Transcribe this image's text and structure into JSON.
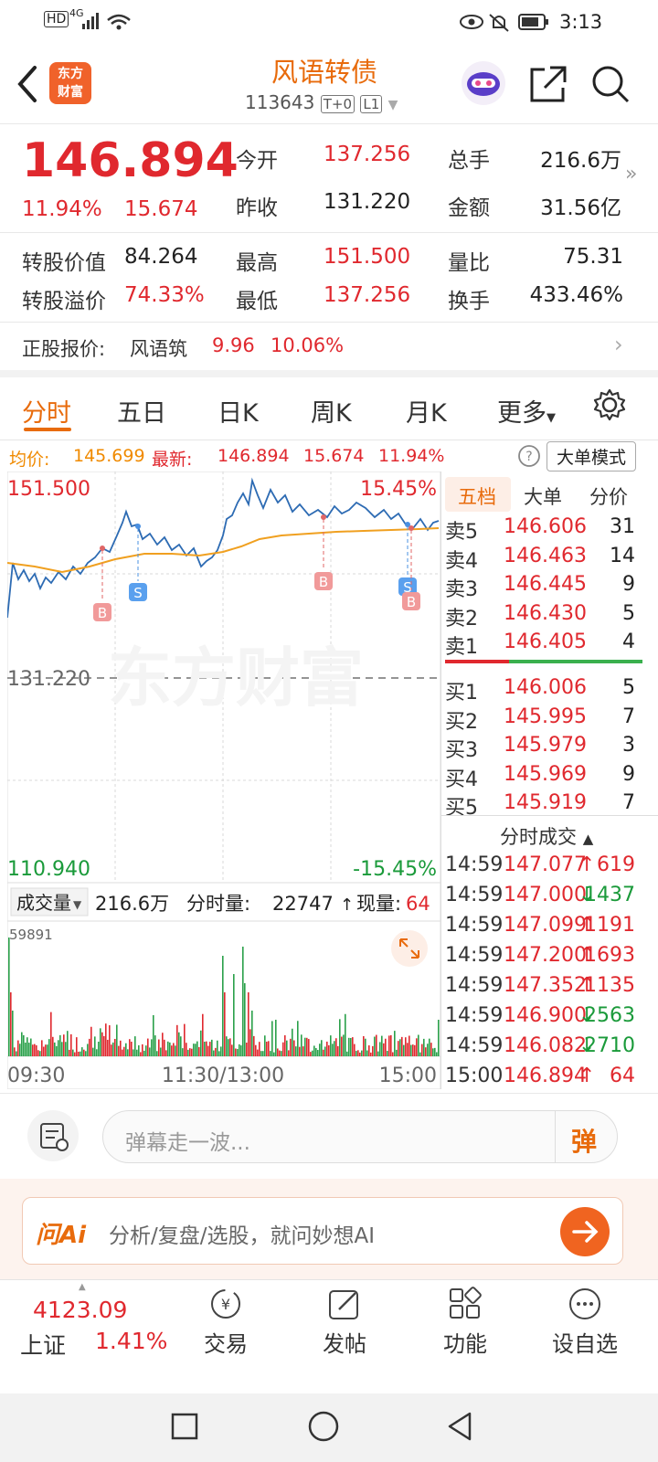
{
  "status_bar": {
    "hd": "HD",
    "net": "4G",
    "time": "3:13"
  },
  "header": {
    "title": "风语转债",
    "code": "113643",
    "badge1": "T+0",
    "badge2": "L1",
    "logo_line1": "东方",
    "logo_line2": "财富"
  },
  "quote": {
    "price": "146.894",
    "pct": "11.94%",
    "chg": "15.674",
    "open_label": "今开",
    "open": "137.256",
    "prev_label": "昨收",
    "prev": "131.220",
    "vol_label": "总手",
    "vol": "216.6万",
    "amt_label": "金额",
    "amt": "31.56亿",
    "conv_value_label": "转股价值",
    "conv_value": "84.264",
    "conv_premium_label": "转股溢价",
    "conv_premium": "74.33%",
    "high_label": "最高",
    "high": "151.500",
    "low_label": "最低",
    "low": "137.256",
    "vr_label": "量比",
    "vr": "75.31",
    "turnover_label": "换手",
    "turnover": "433.46%"
  },
  "underlying": {
    "label": "正股报价:",
    "name": "风语筑",
    "price": "9.96",
    "pct": "10.06%"
  },
  "tabs": [
    "分时",
    "五日",
    "日K",
    "周K",
    "月K",
    "更多"
  ],
  "info_bar": {
    "avg_label": "均价:",
    "avg": "145.699",
    "latest_label": "最新:",
    "latest": "146.894",
    "chg": "15.674",
    "pct": "11.94%",
    "mode_button": "大单模式"
  },
  "chart_data": {
    "type": "line",
    "ylim": [
      110.94,
      151.5
    ],
    "y_labels": {
      "top": "151.500",
      "top_pct": "15.45%",
      "mid": "131.220",
      "bottom": "110.940",
      "bottom_pct": "-15.45%"
    },
    "x_labels": [
      "09:30",
      "11:30/13:00",
      "15:00"
    ],
    "watermark": "东方财富",
    "markers": [
      "B",
      "S",
      "B",
      "S",
      "B"
    ]
  },
  "volume": {
    "label": "成交量",
    "total": "216.6万",
    "minute_label": "分时量:",
    "minute": "22747",
    "now_label": "现量:",
    "now": "64",
    "max": "59891"
  },
  "orderbook": {
    "tabs": [
      "五档",
      "大单",
      "分价"
    ],
    "asks": [
      {
        "label": "卖5",
        "price": "146.606",
        "qty": "31"
      },
      {
        "label": "卖4",
        "price": "146.463",
        "qty": "14"
      },
      {
        "label": "卖3",
        "price": "146.445",
        "qty": "9"
      },
      {
        "label": "卖2",
        "price": "146.430",
        "qty": "5"
      },
      {
        "label": "卖1",
        "price": "146.405",
        "qty": "4"
      }
    ],
    "bids": [
      {
        "label": "买1",
        "price": "146.006",
        "qty": "5"
      },
      {
        "label": "买2",
        "price": "145.995",
        "qty": "7"
      },
      {
        "label": "买3",
        "price": "145.979",
        "qty": "3"
      },
      {
        "label": "买4",
        "price": "145.969",
        "qty": "9"
      },
      {
        "label": "买5",
        "price": "145.919",
        "qty": "7"
      }
    ],
    "trades_title": "分时成交",
    "trades": [
      {
        "time": "14:59",
        "price": "147.077",
        "dir": "↑",
        "qty": "619"
      },
      {
        "time": "14:59",
        "price": "147.000",
        "dir": "↓",
        "qty": "1437"
      },
      {
        "time": "14:59",
        "price": "147.099",
        "dir": "↑",
        "qty": "1191"
      },
      {
        "time": "14:59",
        "price": "147.200",
        "dir": "↑",
        "qty": "1693"
      },
      {
        "time": "14:59",
        "price": "147.352",
        "dir": "↑",
        "qty": "1135"
      },
      {
        "time": "14:59",
        "price": "146.900",
        "dir": "↓",
        "qty": "2563"
      },
      {
        "time": "14:59",
        "price": "146.082",
        "dir": "↓",
        "qty": "2710"
      },
      {
        "time": "15:00",
        "price": "146.894",
        "dir": "↑",
        "qty": "64"
      }
    ]
  },
  "comment": {
    "placeholder": "弹幕走一波...",
    "dan": "弹"
  },
  "ai_bar": {
    "logo": "问Ai",
    "text": "分析/复盘/选股，就问妙想AI"
  },
  "bottom_nav": {
    "index_value": "4123.09",
    "index_name": "上证",
    "index_pct": "1.41%",
    "trade": "交易",
    "post": "发帖",
    "func": "功能",
    "watch": "设自选"
  }
}
